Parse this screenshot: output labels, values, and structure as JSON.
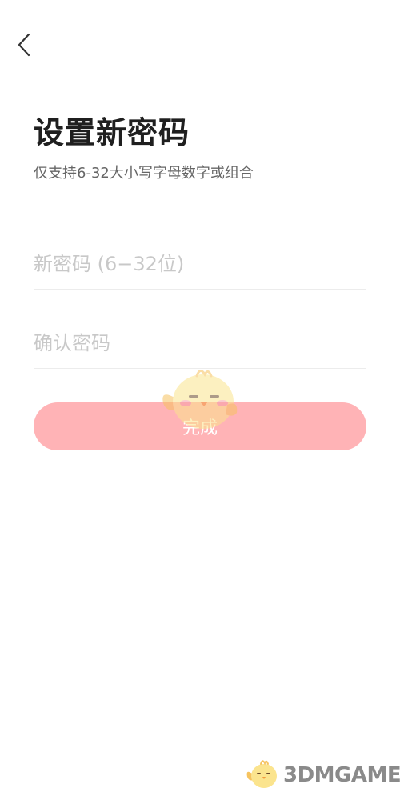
{
  "header": {
    "back_icon": "chevron-left-icon"
  },
  "main": {
    "title": "设置新密码",
    "subtitle": "仅支持6-32大小写字母数字或组合",
    "new_password": {
      "value": "",
      "placeholder": "新密码 (6−32位)"
    },
    "confirm_password": {
      "value": "",
      "placeholder": "确认密码"
    },
    "submit_label": "完成"
  },
  "overlay": {
    "mascot_icon": "chick-mascot-icon",
    "watermark_text": "3DMGAME"
  },
  "colors": {
    "button": "#ffb3b6",
    "button_text": "#ffffff",
    "title": "#1f1f1f",
    "subtitle": "#666666",
    "placeholder": "#c8c8c8",
    "divider": "#ececec"
  }
}
